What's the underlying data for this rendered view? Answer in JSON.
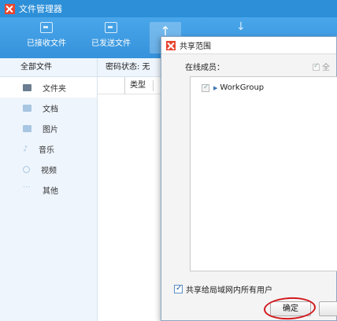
{
  "window": {
    "title": "文件管理器"
  },
  "toolbar": {
    "received_label": "已接收文件",
    "sent_label": "已发送文件"
  },
  "sidebar": {
    "header": "全部文件",
    "items": [
      {
        "label": "文件夹",
        "icon": "folder-icon",
        "active": true
      },
      {
        "label": "文档",
        "icon": "document-icon"
      },
      {
        "label": "图片",
        "icon": "image-icon"
      },
      {
        "label": "音乐",
        "icon": "music-icon"
      },
      {
        "label": "视频",
        "icon": "video-icon"
      },
      {
        "label": "其他",
        "icon": "more-icon"
      }
    ]
  },
  "filepane": {
    "status": "密码状态: 无",
    "column_type": "类型"
  },
  "dialog": {
    "title": "共享范围",
    "online_members_label": "在线成员：",
    "select_all_label": "全",
    "tree": [
      {
        "label": "WorkGroup",
        "checked": true
      }
    ],
    "share_all_label": "共享给局域网内所有用户",
    "share_all_checked": true,
    "ok_label": "确定"
  },
  "colors": {
    "titlebar": "#2c8fd8",
    "toolbar": "#3f9de4",
    "sidebar_bg": "#eef5fc",
    "highlight": "#d3181d"
  }
}
